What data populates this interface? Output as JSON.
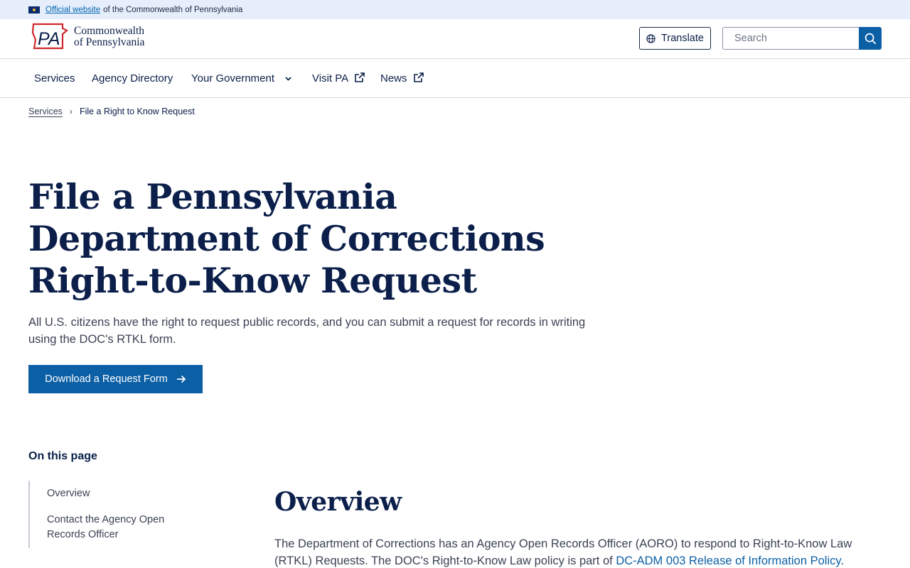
{
  "banner": {
    "link_text": "Official website",
    "text": "of the Commonwealth of Pennsylvania"
  },
  "header": {
    "logo_mark": "PA",
    "logo_line1": "Commonwealth",
    "logo_line2": "of Pennsylvania",
    "translate_label": "Translate",
    "search_placeholder": "Search"
  },
  "nav": {
    "items": [
      {
        "label": "Services"
      },
      {
        "label": "Agency Directory"
      },
      {
        "label": "Your Government"
      },
      {
        "label": "Visit PA"
      },
      {
        "label": "News"
      }
    ]
  },
  "breadcrumb": {
    "parent": "Services",
    "current": "File a Right to Know Request"
  },
  "hero": {
    "title": "File a Pennsylvania Department of Corrections Right-to-Know Request",
    "lead": "All U.S. citizens have the right to request public records, and you can submit a request for records in writing using the DOC's RTKL form.",
    "cta_label": "Download a Request Form"
  },
  "on_this_page": {
    "title": "On this page",
    "items": [
      "Overview",
      "Contact the Agency Open Records Officer"
    ]
  },
  "overview": {
    "title": "Overview",
    "body": "The Department of Corrections has an Agency Open Records Officer (AORO) to respond to Right-to-Know Law (RTKL) Requests. The DOC's Right-to-Know Law policy is part of ",
    "link_text": "DC-ADM 003 Release of Information Policy",
    "body_end": "."
  },
  "colors": {
    "primary_blue": "#0b5fa5",
    "navy": "#0b1f4a",
    "banner_bg": "#e6edfb"
  }
}
